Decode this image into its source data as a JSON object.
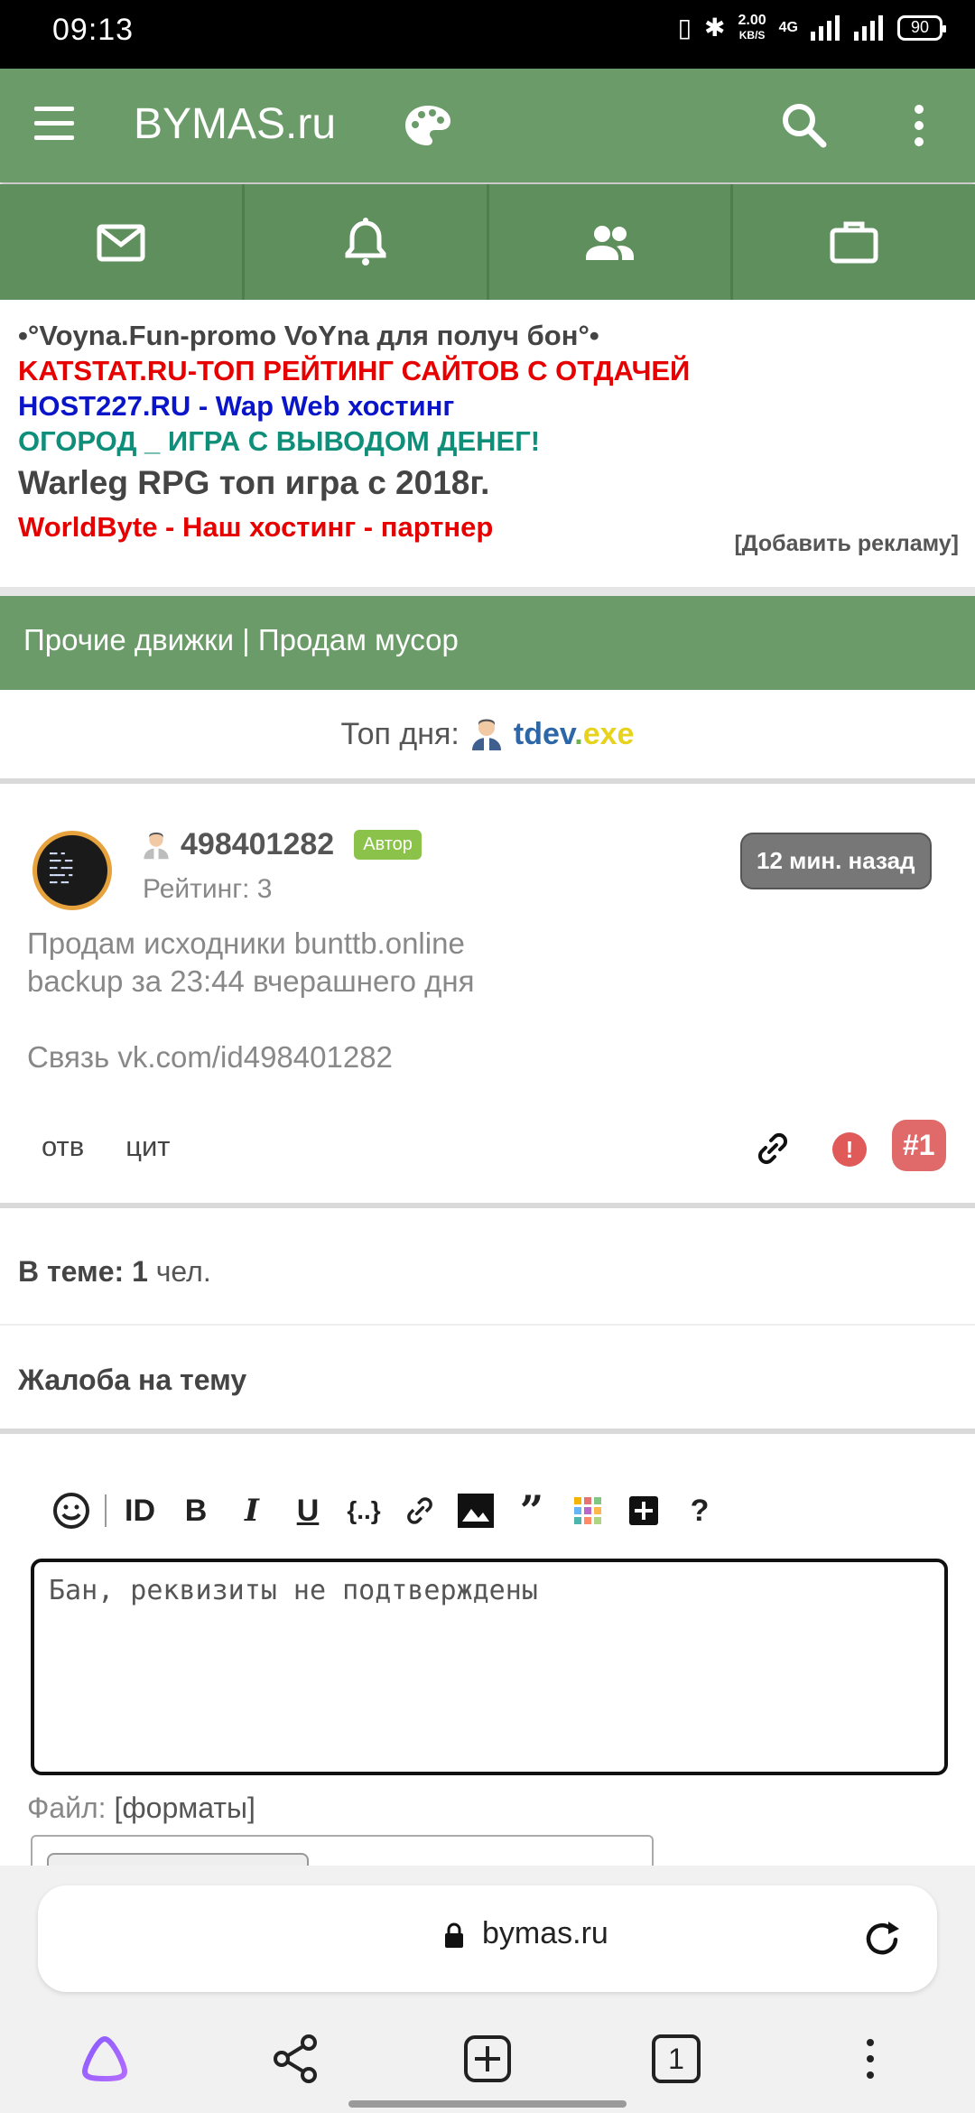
{
  "status_bar": {
    "time": "09:13",
    "net_speed_value": "2.00",
    "net_speed_unit": "KB/S",
    "network": "4G",
    "battery": "90"
  },
  "app_bar": {
    "title": "BYMAS.ru",
    "icons": [
      "menu-icon",
      "palette-icon",
      "search-icon",
      "more-vert-icon"
    ]
  },
  "nav_tabs": [
    "mail-icon",
    "bell-icon",
    "people-icon",
    "briefcase-icon"
  ],
  "ads": {
    "line1": "•°Voyna.Fun-promo VoYna для получ бон°•",
    "line2": "KATSTAT.RU-ТОП РЕЙТИНГ САЙТОВ С ОТДАЧЕЙ",
    "line3": "HOST227.RU - Wap Web хостинг",
    "line4": "ОГОРОД _ ИГРА С ВЫВОДОМ ДЕНЕГ!",
    "line5": "Warleg RPG топ игра с 2018г.",
    "line6": "WorldByte - Наш хостинг - партнер",
    "add_ad": "[Добавить рекламу]"
  },
  "section": {
    "breadcrumb": "Прочие движки | Продам мусор"
  },
  "top_day": {
    "label": "Топ дня:",
    "user_part1": "tdev",
    "user_part2": ".",
    "user_part3": "exe"
  },
  "post": {
    "username": "498401282",
    "badge": "Автор",
    "rating": "Рейтинг: 3",
    "time": "12 мин. назад",
    "text": "Продам исходники bunttb.online\nbackup за 23:44 вчерашнего дня\n\nСвязь vk.com/id498401282",
    "reply": "отв",
    "quote": "цит",
    "warn": "!",
    "number": "#1"
  },
  "topic": {
    "in_topic_label": "В теме:",
    "in_topic_count": "1",
    "in_topic_unit": "чел.",
    "complaint": "Жалоба на тему"
  },
  "editor": {
    "toolbar": [
      "smile-icon",
      "id-icon",
      "bold-icon",
      "italic-icon",
      "underline-icon",
      "code-icon",
      "link-icon",
      "image-icon",
      "quote-icon",
      "color-icon",
      "plus-icon",
      "help-icon"
    ],
    "value": "Бан, реквизиты не подтверждены",
    "file_label": "Файл:",
    "formats": "[форматы]"
  },
  "browser": {
    "url": "bymas.ru",
    "tabs_count": "1"
  },
  "colors": {
    "green": "#6c9b6a",
    "green_dark": "#5e8f5c",
    "red": "#e60000",
    "blue": "#0a14c8",
    "teal": "#0f8f7a"
  }
}
